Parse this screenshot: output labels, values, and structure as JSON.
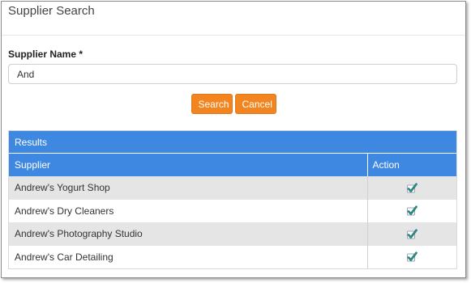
{
  "dialog": {
    "title": "Supplier Search"
  },
  "form": {
    "supplier_name_label": "Supplier Name *",
    "supplier_name_value": "And"
  },
  "buttons": {
    "search": "Search",
    "cancel": "Cancel"
  },
  "results": {
    "heading": "Results",
    "columns": {
      "supplier": "Supplier",
      "action": "Action"
    },
    "rows": [
      {
        "supplier": "Andrew's Yogurt Shop",
        "action_icon": "checkmark-icon"
      },
      {
        "supplier": "Andrew's Dry Cleaners",
        "action_icon": "checkmark-icon"
      },
      {
        "supplier": "Andrew's Photography Studio",
        "action_icon": "checkmark-icon"
      },
      {
        "supplier": "Andrew's Car Detailing",
        "action_icon": "checkmark-icon"
      }
    ]
  },
  "colors": {
    "accent_button": "#f28520",
    "results_header": "#3e88e2",
    "row_stripe": "#e5e5e5",
    "check_green": "#2ea043",
    "check_blue": "#1f5fb8"
  }
}
